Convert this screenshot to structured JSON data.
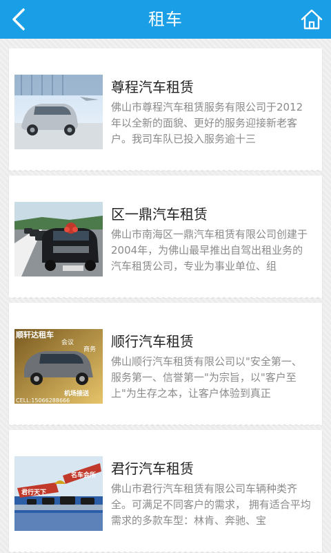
{
  "header": {
    "title": "租车",
    "back_icon": "chevron-left-icon",
    "home_icon": "home-icon",
    "color": "#1a9ee6"
  },
  "listings": [
    {
      "name": "尊程汽车租赁",
      "description": "佛山市尊程汽车租赁服务有限公司于2012年以全新的面貌、更好的服务迎接新老客户。我司车队已投入服务逾十三"
    },
    {
      "name": "区一鼎汽车租赁",
      "description": "佛山市南海区一鼎汽车租赁有限公司创建于2004年，为佛山最早推出自驾出租业务的汽车租赁公司，专业为事业单位、组"
    },
    {
      "name": "顺行汽车租赁",
      "description": "佛山顺行汽车租赁有限公司以\"安全第一、服务第一、信誉第一\"为宗旨，以\"客户至上\"为生存之本，让客户体验到真正",
      "image_text": {
        "brand": "顺轩达租车",
        "tag1": "会议",
        "tag2": "商务",
        "tag3": "机场接送",
        "phone": "CELL:15066288666"
      }
    },
    {
      "name": "君行汽车租赁",
      "description": "佛山市君行汽车租赁有限公司车辆种类齐全。可满足不同客户的需求， 拥有适合平均需求的多款车型：林肯、奔驰、宝",
      "image_text": {
        "sign1": "君行天下",
        "sign2": "名车会所"
      }
    }
  ]
}
